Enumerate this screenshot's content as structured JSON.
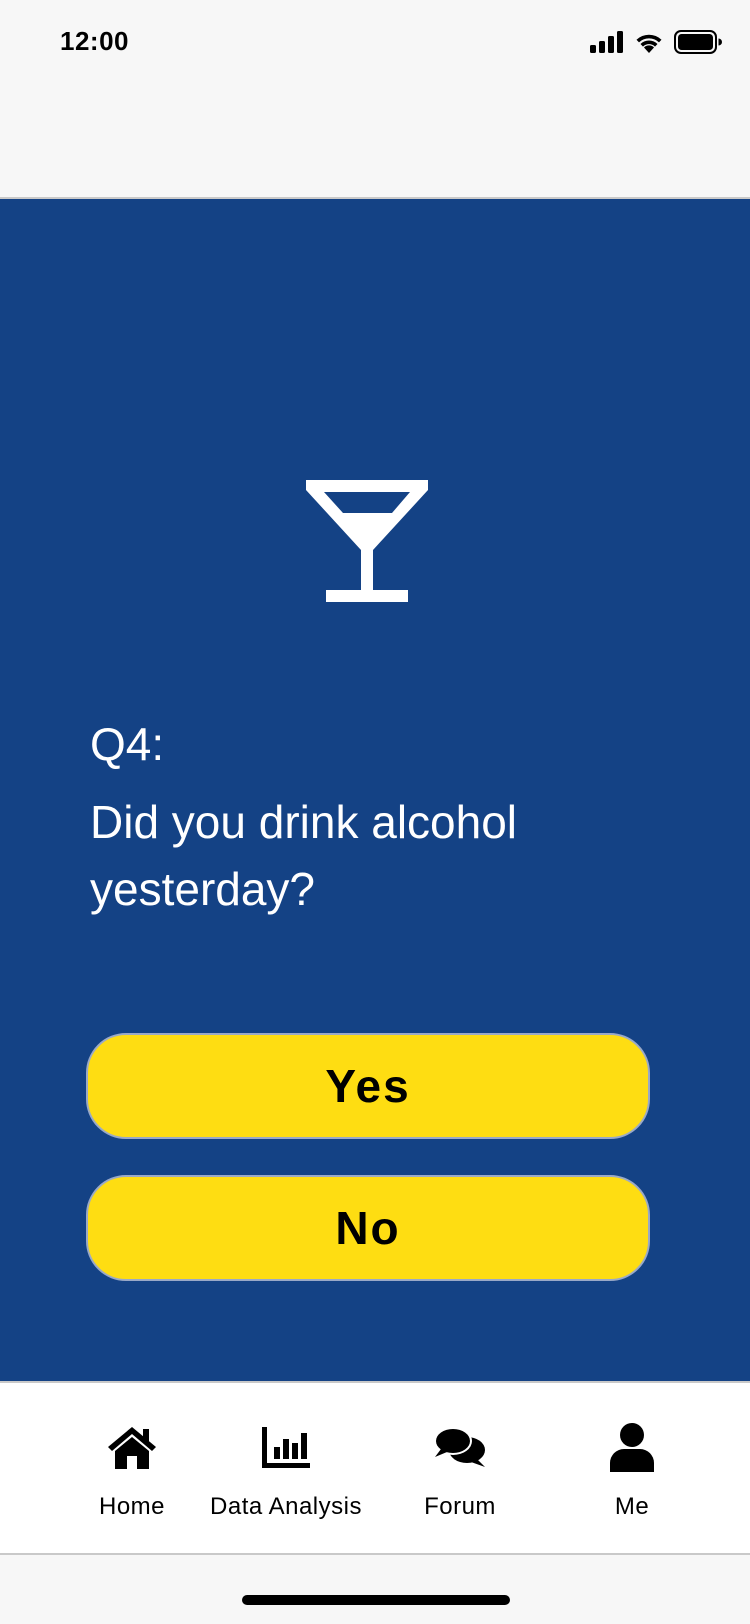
{
  "status_bar": {
    "time": "12:00",
    "icons": [
      "cellular-signal-icon",
      "wifi-icon",
      "battery-icon"
    ]
  },
  "question": {
    "icon": "cocktail-glass-icon",
    "number": "Q4:",
    "text": "Did you drink alcohol yesterday?"
  },
  "answers": {
    "yes_label": "Yes",
    "no_label": "No"
  },
  "tab_bar": {
    "items": [
      {
        "label": "Home",
        "icon": "home-icon"
      },
      {
        "label": "Data Analysis",
        "icon": "bar-chart-icon"
      },
      {
        "label": "Forum",
        "icon": "chat-bubbles-icon"
      },
      {
        "label": "Me",
        "icon": "user-icon"
      }
    ]
  },
  "colors": {
    "panel_background": "#144285",
    "button_background": "#fedd12",
    "text_light": "#ffffff",
    "text_dark": "#000000"
  }
}
